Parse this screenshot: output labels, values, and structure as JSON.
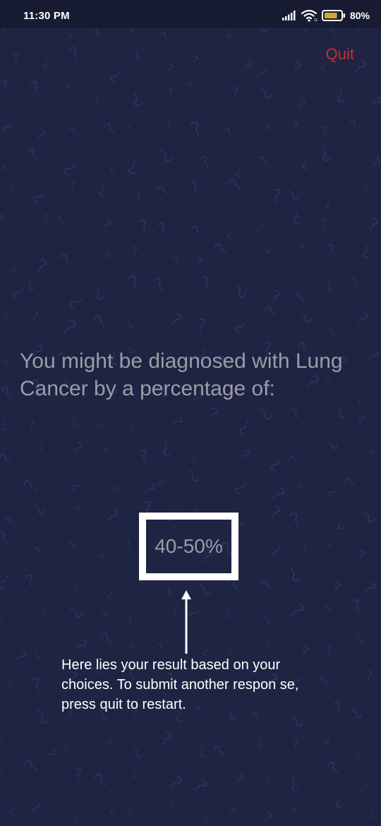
{
  "status_bar": {
    "time": "11:30 PM",
    "battery_percent": "80%",
    "battery_level": 0.8,
    "icons": [
      "signal-icon",
      "wifi-icon",
      "battery-icon"
    ]
  },
  "header": {
    "quit_label": "Quit"
  },
  "main": {
    "prompt": "You might be diagnosed with Lung Cancer by a percentage of:",
    "result": "40-50%",
    "hint": "Here lies your result based on your choices. To submit another respon se, press quit to restart."
  },
  "colors": {
    "background": "#1f2443",
    "quit": "#c8302a",
    "text_muted": "#9b9ca8",
    "box_border": "#ffffff",
    "battery_fill": "#d9a62b"
  }
}
